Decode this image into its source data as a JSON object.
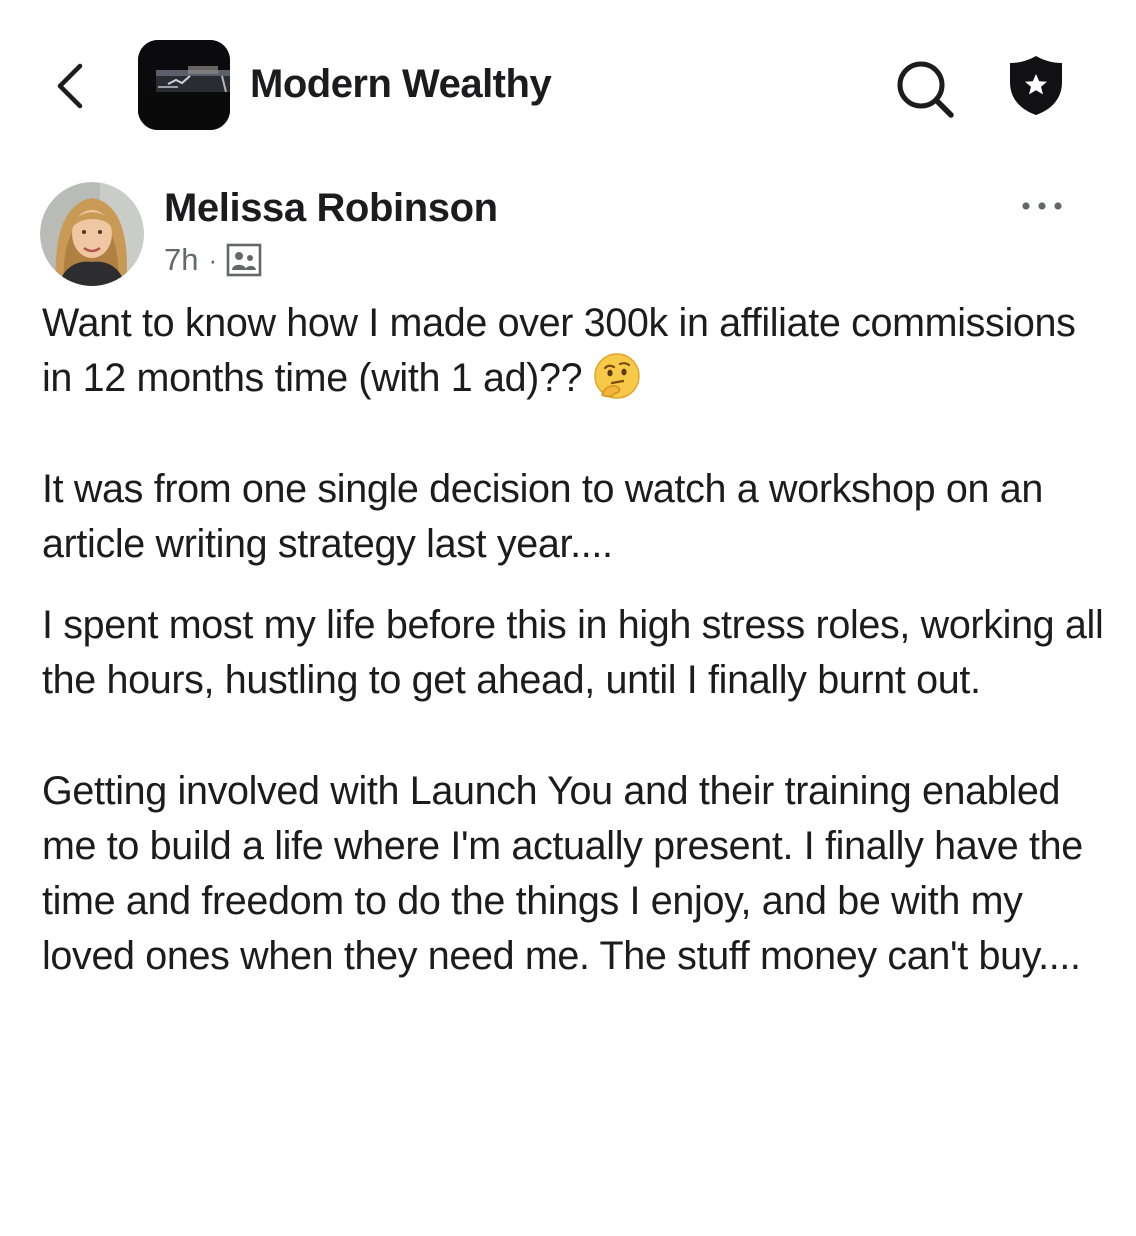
{
  "header": {
    "group_name": "Modern Wealthy",
    "back_icon": "chevron-left-icon",
    "search_icon": "search-icon",
    "admin_icon": "shield-star-icon"
  },
  "post": {
    "author": "Melissa Robinson",
    "time": "7h",
    "separator": "·",
    "audience_icon": "group-members-icon",
    "more_icon": "more-horizontal-icon",
    "paragraphs": [
      "Want to know how I made over 300k in affiliate commissions in 12 months time (with 1 ad)??",
      "It was from one single decision to watch a workshop on an article writing strategy last year....",
      "I spent most my life before this in high stress roles, working all the hours, hustling to get ahead, until I finally burnt out.",
      "Getting involved with Launch You and their training enabled me to build a life where I'm actually present. I finally have the time and freedom to do the things I enjoy, and be with my loved ones when they need me. The stuff money can't buy...."
    ],
    "emoji": "thinking-face-emoji"
  },
  "colors": {
    "text": "#1c1c1e",
    "secondary_text": "#65676b",
    "emoji_yellow": "#f7c948"
  }
}
